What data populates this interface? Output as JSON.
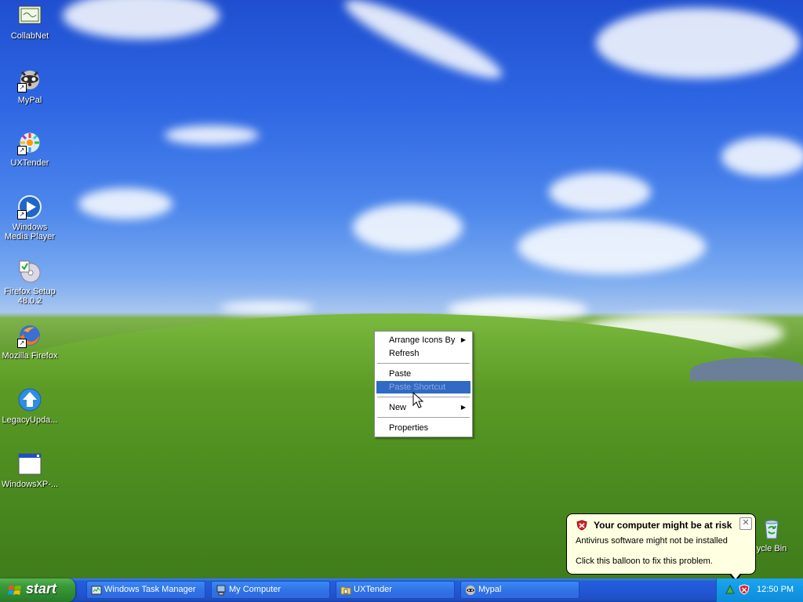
{
  "desktop_icons": [
    {
      "name": "collabnet",
      "label": "CollabNet",
      "icon": "certificate-icon"
    },
    {
      "name": "mypal",
      "label": "MyPal",
      "icon": "raccoon-icon"
    },
    {
      "name": "uxtender",
      "label": "UXTender",
      "icon": "uxtender-icon"
    },
    {
      "name": "windows-media-player",
      "label": "Windows Media Player",
      "icon": "media-player-icon"
    },
    {
      "name": "firefox-setup",
      "label": "Firefox Setup 48.0.2",
      "icon": "installer-disc-icon"
    },
    {
      "name": "mozilla-firefox",
      "label": "Mozilla Firefox",
      "icon": "firefox-icon"
    },
    {
      "name": "legacyupdate",
      "label": "LegacyUpda...",
      "icon": "update-arrow-icon"
    },
    {
      "name": "windowsxp",
      "label": "WindowsXP-...",
      "icon": "window-icon"
    }
  ],
  "recycle_bin": {
    "label": "Recycle Bin",
    "visible_label": "ycle Bin"
  },
  "context_menu": {
    "items": [
      {
        "label": "Arrange Icons By",
        "submenu": true
      },
      {
        "label": "Refresh"
      },
      {
        "label": "Paste"
      },
      {
        "label": "Paste Shortcut",
        "selected": true,
        "disabled": true
      },
      {
        "label": "New",
        "submenu": true
      },
      {
        "label": "Properties"
      }
    ]
  },
  "balloon": {
    "title": "Your computer might be at risk",
    "line1": "Antivirus software might not be installed",
    "line2": "Click this balloon to fix this problem.",
    "close_glyph": "✕"
  },
  "taskbar": {
    "start_label": "start",
    "buttons": [
      {
        "label": "Windows Task Manager",
        "icon": "task-manager-icon"
      },
      {
        "label": "My Computer",
        "icon": "my-computer-icon"
      },
      {
        "label": "UXTender",
        "icon": "folder-icon"
      },
      {
        "label": "Mypal",
        "icon": "raccoon-icon"
      }
    ],
    "clock": "12:50 PM"
  },
  "colors": {
    "taskbar_blue": "#245edb",
    "start_green": "#3c9a3b",
    "tray_blue": "#149ae8",
    "menu_highlight": "#316ac5",
    "balloon_bg": "#ffffe1"
  }
}
